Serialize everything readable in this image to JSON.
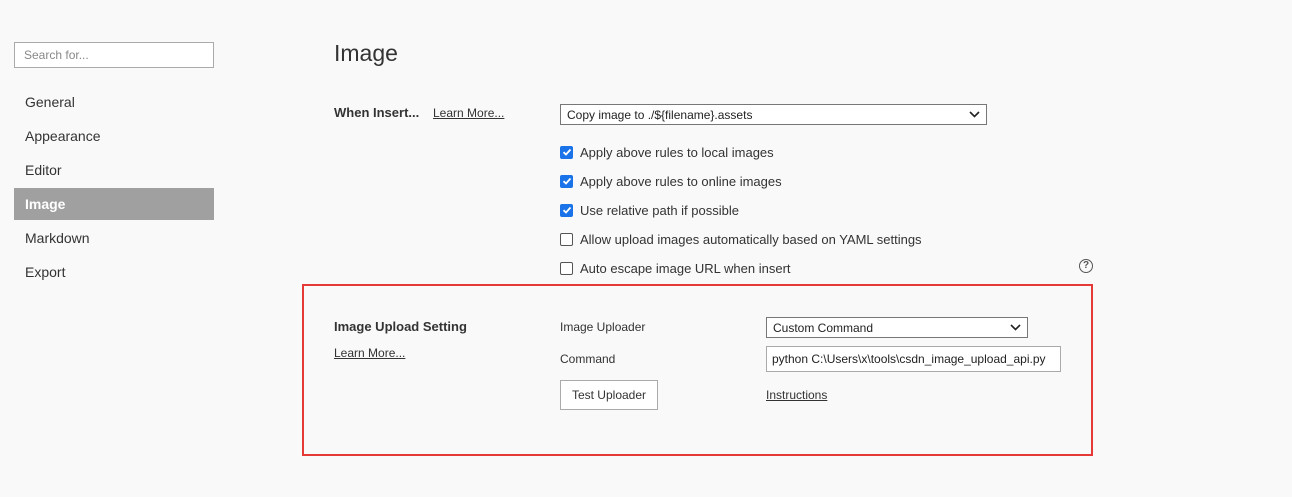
{
  "sidebar": {
    "search_placeholder": "Search for...",
    "items": [
      {
        "label": "General",
        "active": false
      },
      {
        "label": "Appearance",
        "active": false
      },
      {
        "label": "Editor",
        "active": false
      },
      {
        "label": "Image",
        "active": true
      },
      {
        "label": "Markdown",
        "active": false
      },
      {
        "label": "Export",
        "active": false
      }
    ]
  },
  "main": {
    "title": "Image",
    "when_insert": {
      "label": "When Insert...",
      "learn_more": "Learn More...",
      "select_value": "Copy image to ./${filename}.assets"
    },
    "options": [
      {
        "label": "Apply above rules to local images",
        "checked": true
      },
      {
        "label": "Apply above rules to online images",
        "checked": true
      },
      {
        "label": "Use relative path if possible",
        "checked": true
      },
      {
        "label": "Allow upload images automatically based on YAML settings",
        "checked": false
      },
      {
        "label": "Auto escape image URL when insert",
        "checked": false
      }
    ],
    "help_icon": "question-circle-icon",
    "upload": {
      "label": "Image Upload Setting",
      "learn_more": "Learn More...",
      "uploader_label": "Image Uploader",
      "uploader_value": "Custom Command",
      "command_label": "Command",
      "command_value": "python C:\\Users\\x\\tools\\csdn_image_upload_api.py",
      "test_button": "Test Uploader",
      "instructions": "Instructions"
    }
  },
  "colors": {
    "accent": "#1a73e8",
    "active_nav": "#a0a0a0",
    "highlight_frame": "#e53935"
  }
}
